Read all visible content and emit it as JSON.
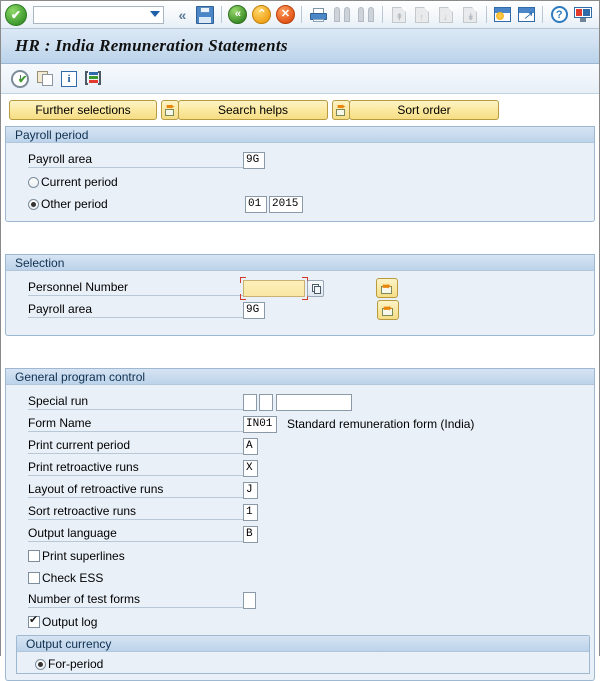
{
  "toolbar": {
    "ok_icon": "ok-check-icon",
    "command_value": "",
    "command_placeholder": "",
    "icons": [
      {
        "name": "back-chevron-icon",
        "glyph": "«"
      },
      {
        "name": "save-icon",
        "glyph": ""
      },
      {
        "name": "back-icon",
        "glyph": "«"
      },
      {
        "name": "exit-icon",
        "glyph": "⌃"
      },
      {
        "name": "cancel-icon",
        "glyph": "✕"
      },
      {
        "name": "print-icon",
        "glyph": ""
      },
      {
        "name": "find-icon",
        "glyph": ""
      },
      {
        "name": "find-next-icon",
        "glyph": ""
      },
      {
        "name": "first-page-icon",
        "glyph": ""
      },
      {
        "name": "previous-page-icon",
        "glyph": ""
      },
      {
        "name": "next-page-icon",
        "glyph": ""
      },
      {
        "name": "last-page-icon",
        "glyph": ""
      },
      {
        "name": "create-session-icon",
        "glyph": ""
      },
      {
        "name": "create-shortcut-icon",
        "glyph": "↗"
      },
      {
        "name": "help-icon",
        "glyph": "?"
      },
      {
        "name": "customize-local-layout-icon",
        "glyph": ""
      }
    ]
  },
  "title": "HR : India Remuneration Statements",
  "app_toolbar": [
    {
      "name": "execute-icon",
      "label": "Execute"
    },
    {
      "name": "copy-icon",
      "label": "Get Variant"
    },
    {
      "name": "info-icon",
      "label": "Information"
    },
    {
      "name": "variant-icon",
      "label": "Display Variant"
    }
  ],
  "buttons": {
    "further_selections": "Further selections",
    "search_helps": "Search helps",
    "sort_order": "Sort order"
  },
  "payroll_period": {
    "section_title": "Payroll period",
    "payroll_area_label": "Payroll area",
    "payroll_area_value": "9G",
    "current_period_label": "Current period",
    "current_period_selected": false,
    "other_period_label": "Other period",
    "other_period_selected": true,
    "other_period_period": "01",
    "other_period_year": "2015"
  },
  "selection": {
    "section_title": "Selection",
    "personnel_number_label": "Personnel Number",
    "personnel_number_value": "",
    "payroll_area_label": "Payroll area",
    "payroll_area_value": "9G"
  },
  "general_program_control": {
    "section_title": "General program control",
    "special_run_label": "Special run",
    "special_run_a": "",
    "special_run_b": "",
    "special_run_c": "",
    "form_name_label": "Form Name",
    "form_name_value": "IN01",
    "form_name_text": "Standard remuneration form (India)",
    "print_current_period_label": "Print current period",
    "print_current_period_value": "A",
    "print_retroactive_runs_label": "Print retroactive runs",
    "print_retroactive_runs_value": "X",
    "layout_retroactive_label": "Layout of retroactive runs",
    "layout_retroactive_value": "J",
    "sort_retroactive_label": "Sort retroactive runs",
    "sort_retroactive_value": "1",
    "output_language_label": "Output language",
    "output_language_value": "B",
    "print_superlines_label": "Print superlines",
    "print_superlines_checked": false,
    "check_ess_label": "Check ESS",
    "check_ess_checked": false,
    "number_test_forms_label": "Number of test forms",
    "number_test_forms_value": "",
    "output_log_label": "Output log",
    "output_log_checked": true,
    "output_currency": {
      "section_title": "Output currency",
      "for_period_label": "For-period",
      "for_period_selected": true
    }
  },
  "colors": {
    "accent": "#4a86c8",
    "button_yellow": "#f6dd84",
    "focus_red": "#d03a2a",
    "section_bg": "#e9f0f8"
  }
}
